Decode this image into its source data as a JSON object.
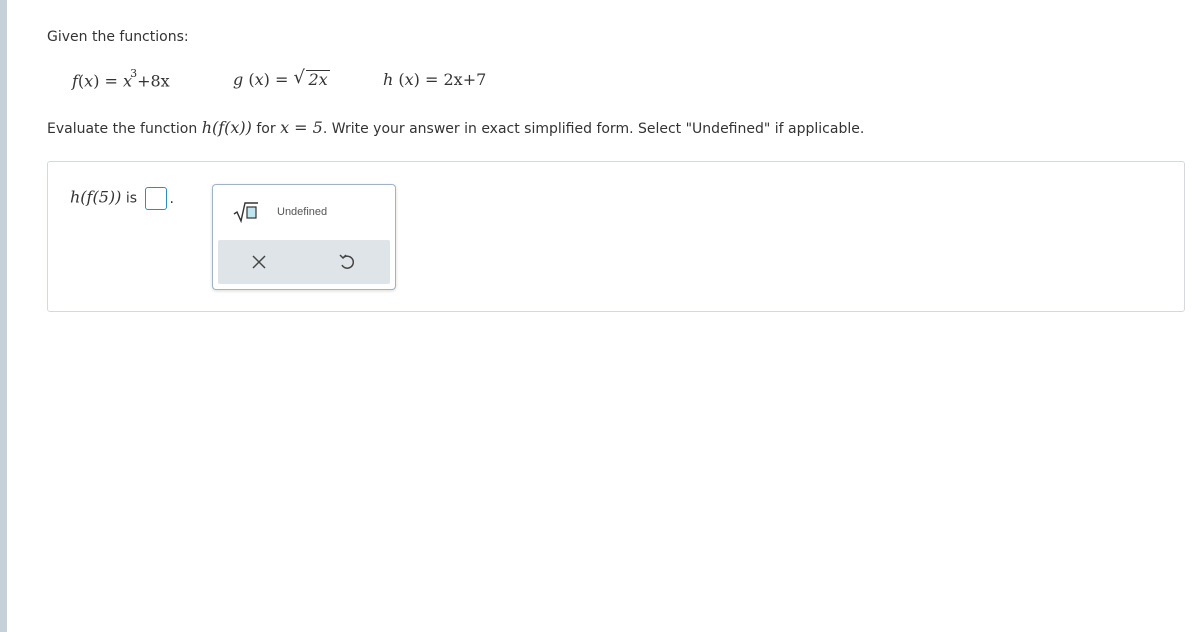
{
  "intro": "Given the functions:",
  "functions": {
    "f": {
      "lhs": "f",
      "var": "x",
      "rhs_base": "x",
      "rhs_exp": "3",
      "rhs_rest": "+8x"
    },
    "g": {
      "lhs": "g",
      "var": "x",
      "radicand": "2x"
    },
    "h": {
      "lhs": "h",
      "var": "x",
      "rhs": "2x+7"
    }
  },
  "question": {
    "prefix": "Evaluate the function",
    "composition": "h(f(x))",
    "mid": "for",
    "condition": "x = 5",
    "suffix": ". Write your answer in exact simplified form. Select \"Undefined\" if applicable."
  },
  "answer": {
    "expression": "h(f(5))",
    "is_label": "is",
    "period": ".",
    "input_value": ""
  },
  "palette": {
    "sqrt_icon": "sqrt-template-icon",
    "undefined_label": "Undefined",
    "clear_icon": "x-icon",
    "undo_icon": "undo-icon"
  },
  "colors": {
    "accent": "#2a8fbd",
    "rail": "#c5d0d8",
    "palette_bottom": "#dfe4e8"
  }
}
